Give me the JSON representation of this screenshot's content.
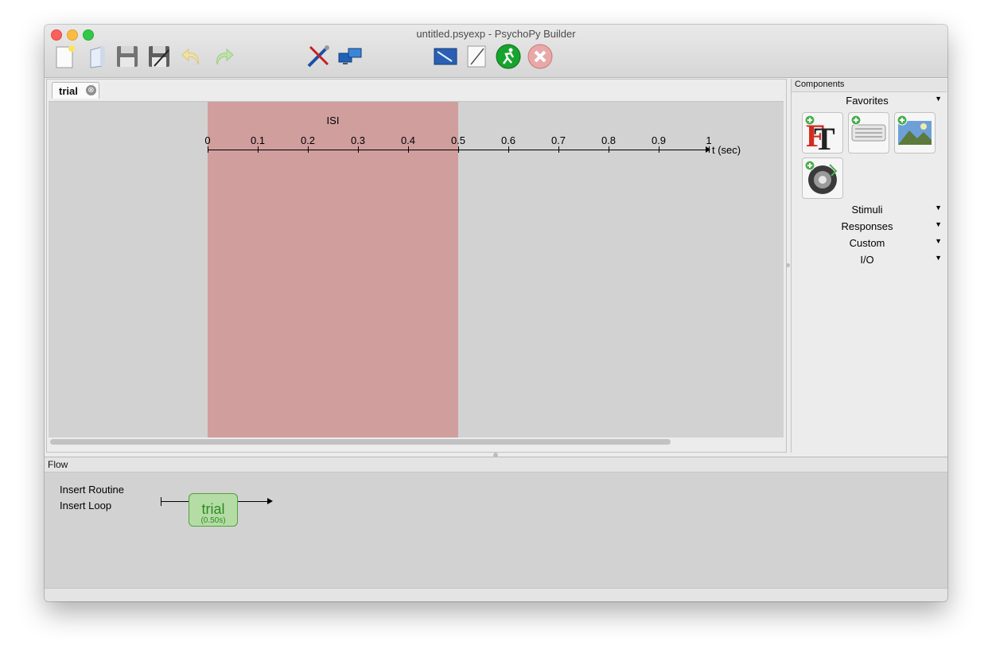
{
  "window": {
    "title": "untitled.psyexp - PsychoPy Builder"
  },
  "toolbar": {
    "buttons": [
      "new-file",
      "open-file",
      "save",
      "save-as",
      "undo",
      "redo",
      "preferences",
      "monitor-center",
      "experiment-settings",
      "edit-code",
      "run",
      "stop"
    ]
  },
  "routine": {
    "tab_label": "trial",
    "tab_close": "⊗",
    "component_label": "ISI",
    "component_start": 0,
    "component_stop": 0.5,
    "axis_unit": "t (sec)",
    "ticks": [
      "0",
      "0.1",
      "0.2",
      "0.3",
      "0.4",
      "0.5",
      "0.6",
      "0.7",
      "0.8",
      "0.9",
      "1"
    ]
  },
  "components": {
    "title": "Components",
    "favorites_label": "Favorites",
    "favorites": [
      "text",
      "keyboard",
      "image",
      "sound"
    ],
    "categories": [
      "Stimuli",
      "Responses",
      "Custom",
      "I/O"
    ],
    "arrow": "▼"
  },
  "flow": {
    "title": "Flow",
    "insert_routine": "Insert Routine",
    "insert_loop": "Insert Loop",
    "routine_name": "trial",
    "routine_duration": "(0.50s)"
  }
}
